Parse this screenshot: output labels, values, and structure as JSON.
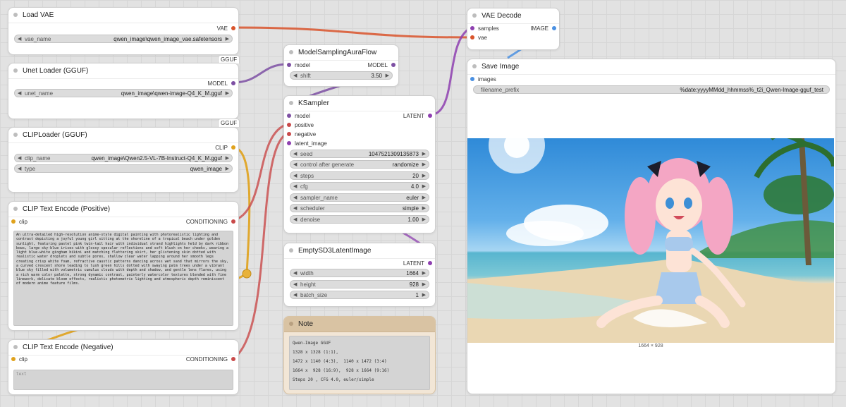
{
  "colors": {
    "vae": "#d9542b",
    "model": "#7d4fa3",
    "clip": "#e0a21c",
    "conditioning": "#c94a4a",
    "latent": "#8e3fb0",
    "image": "#4a90e2"
  },
  "nodes": {
    "load_vae": {
      "title": "Load VAE",
      "output": "VAE",
      "vae_name_label": "vae_name",
      "vae_name_value": "qwen_image\\qwen_image_vae.safetensors"
    },
    "unet_loader": {
      "title": "Unet Loader (GGUF)",
      "output": "MODEL",
      "unet_name_label": "unet_name",
      "unet_name_value": "qwen_image\\qwen-image-Q4_K_M.gguf",
      "tag": "GGUF"
    },
    "clip_loader": {
      "title": "CLIPLoader (GGUF)",
      "output": "CLIP",
      "clip_name_label": "clip_name",
      "clip_name_value": "qwen_image\\Qwen2.5-VL-7B-Instruct-Q4_K_M.gguf",
      "type_label": "type",
      "type_value": "qwen_image",
      "tag": "GGUF"
    },
    "clip_pos": {
      "title": "CLIP Text Encode (Positive)",
      "input": "clip",
      "output": "CONDITIONING",
      "text": "An ultra-detailed high-resolution anime-style digital painting with photorealistic lighting and contrast depicting a joyful young girl sitting at the shoreline of a tropical beach under golden sunlight, featuring pastel pink twin-tail hair with individual strand highlights held by dark ribbon bows, large sky-blue irises with glossy specular reflections and soft blush on her cheeks, wearing a light blue-white gingham bikini and matching fluttering skirt, her glistening skin dotted with realistic water droplets and subtle pores, shallow clear water lapping around her smooth legs creating crisp white foam, refractive caustic patterns dancing across wet sand that mirrors the sky, a curved crescent shore leading to lush green hills dotted with swaying palm trees under a vibrant blue sky filled with volumetric cumulus clouds with depth and shadow, and gentle lens flares, using a rich warm color palette, strong dynamic contrast, painterly watercolor textures blended with fine linework, delicate bloom effects, realistic photometric lighting and atmospheric depth reminiscent of modern anime feature films."
    },
    "clip_neg": {
      "title": "CLIP Text Encode (Negative)",
      "input": "clip",
      "output": "CONDITIONING",
      "placeholder": "text"
    },
    "model_sampling": {
      "title": "ModelSamplingAuraFlow",
      "input": "model",
      "output": "MODEL",
      "shift_label": "shift",
      "shift_value": "3.50"
    },
    "ksampler": {
      "title": "KSampler",
      "inputs": [
        "model",
        "positive",
        "negative",
        "latent_image"
      ],
      "output": "LATENT",
      "widgets": [
        {
          "label": "seed",
          "value": "1047521309135873"
        },
        {
          "label": "control after generate",
          "value": "randomize"
        },
        {
          "label": "steps",
          "value": "20"
        },
        {
          "label": "cfg",
          "value": "4.0"
        },
        {
          "label": "sampler_name",
          "value": "euler"
        },
        {
          "label": "scheduler",
          "value": "simple"
        },
        {
          "label": "denoise",
          "value": "1.00"
        }
      ]
    },
    "empty_latent": {
      "title": "EmptySD3LatentImage",
      "output": "LATENT",
      "widgets": [
        {
          "label": "width",
          "value": "1664"
        },
        {
          "label": "height",
          "value": "928"
        },
        {
          "label": "batch_size",
          "value": "1"
        }
      ]
    },
    "note": {
      "title": "Note",
      "lines": [
        "Qwen-Image GGUF",
        "1328 x 1328 (1:1),",
        "1472 x 1140 (4:3),  1140 x 1472 (3:4)",
        "1664 x  928 (16:9),  928 x 1664 (9:16)",
        "Steps 20 , CFG 4.0, euler/simple"
      ]
    },
    "vae_decode": {
      "title": "VAE Decode",
      "inputs": [
        "samples",
        "vae"
      ],
      "output": "IMAGE"
    },
    "save_image": {
      "title": "Save Image",
      "input": "images",
      "filename_prefix_label": "filename_prefix",
      "filename_prefix_value": "%date:yyyyMMdd_hhmmss%_t2i_Qwen-Image-gguf_test",
      "image_size": "1664 × 928"
    }
  }
}
